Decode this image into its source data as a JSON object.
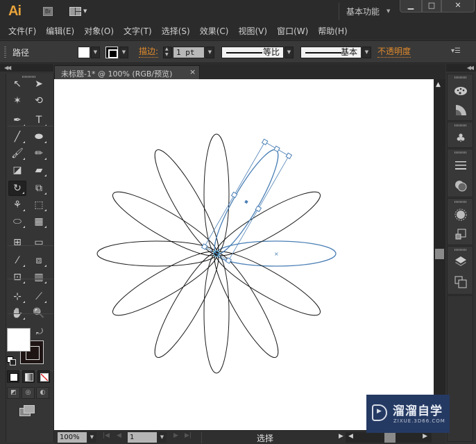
{
  "app": {
    "logo": "Ai",
    "bridge_label": "Br",
    "workspace": "基本功能",
    "window_buttons": {
      "minimize": "▁",
      "maximize": "□",
      "close": "✕"
    }
  },
  "menu": [
    "文件(F)",
    "编辑(E)",
    "对象(O)",
    "文字(T)",
    "选择(S)",
    "效果(C)",
    "视图(V)",
    "窗口(W)",
    "帮助(H)"
  ],
  "control_bar": {
    "selection_type": "路径",
    "fill_color": "#ffffff",
    "stroke_label": "描边:",
    "stroke_weight": "1 pt",
    "variable_width_profile": "等比",
    "brush_definition": "基本",
    "opacity_label": "不透明度"
  },
  "document": {
    "tab_title": "未标题-1* @ 100% (RGB/预览)",
    "tab_close": "×",
    "artwork": {
      "description": "flower made of rotated elliptical petals around a shared anchor",
      "petal_count_black": 11,
      "selected_petal_rotation_deg": 60,
      "original_petal_rotation_deg": 0,
      "rotation_step_deg": 30,
      "stroke_color": "#1a1a1a",
      "selection_color": "#4a7fb5"
    }
  },
  "status_bar": {
    "zoom": "100%",
    "artboard": "1",
    "current_tool": "选择"
  },
  "tools": [
    {
      "name": "selection-tool",
      "glyph": "↖"
    },
    {
      "name": "direct-selection-tool",
      "glyph": "➤"
    },
    {
      "name": "magic-wand-tool",
      "glyph": "✶"
    },
    {
      "name": "lasso-tool",
      "glyph": "⟲"
    },
    {
      "name": "pen-tool",
      "glyph": "✒"
    },
    {
      "name": "type-tool",
      "glyph": "T"
    },
    {
      "name": "line-segment-tool",
      "glyph": "╱"
    },
    {
      "name": "ellipse-tool",
      "glyph": "⬬"
    },
    {
      "name": "paintbrush-tool",
      "glyph": "🖌"
    },
    {
      "name": "pencil-tool",
      "glyph": "✏"
    },
    {
      "name": "blob-brush-tool",
      "glyph": "◪"
    },
    {
      "name": "eraser-tool",
      "glyph": "▰"
    },
    {
      "name": "rotate-tool",
      "glyph": "↻"
    },
    {
      "name": "scale-tool",
      "glyph": "⧉"
    },
    {
      "name": "warp-tool",
      "glyph": "⚘"
    },
    {
      "name": "free-transform-tool",
      "glyph": "⬚"
    },
    {
      "name": "shape-builder-tool",
      "glyph": "⬭"
    },
    {
      "name": "graph-tool",
      "glyph": "▦"
    },
    {
      "name": "mesh-tool",
      "glyph": "⊞"
    },
    {
      "name": "gradient-tool",
      "glyph": "▭"
    },
    {
      "name": "eyedropper-tool",
      "glyph": "⁄"
    },
    {
      "name": "blend-tool",
      "glyph": "⧈"
    },
    {
      "name": "symbol-sprayer-tool",
      "glyph": "⊡"
    },
    {
      "name": "column-graph-tool",
      "glyph": "▥"
    },
    {
      "name": "artboard-tool",
      "glyph": "⊹"
    },
    {
      "name": "slice-tool",
      "glyph": "⟋"
    },
    {
      "name": "hand-tool",
      "glyph": "✋"
    },
    {
      "name": "zoom-tool",
      "glyph": "🔍"
    }
  ],
  "color_controls": {
    "fill": "#ffffff",
    "stroke": "#1e1414",
    "swap_glyph": "⤾"
  },
  "draw_modes": [
    "◩",
    "◎",
    "◐"
  ],
  "watermark": {
    "title": "溜溜自学",
    "subtitle": "ZIXUE.3D66.COM"
  }
}
